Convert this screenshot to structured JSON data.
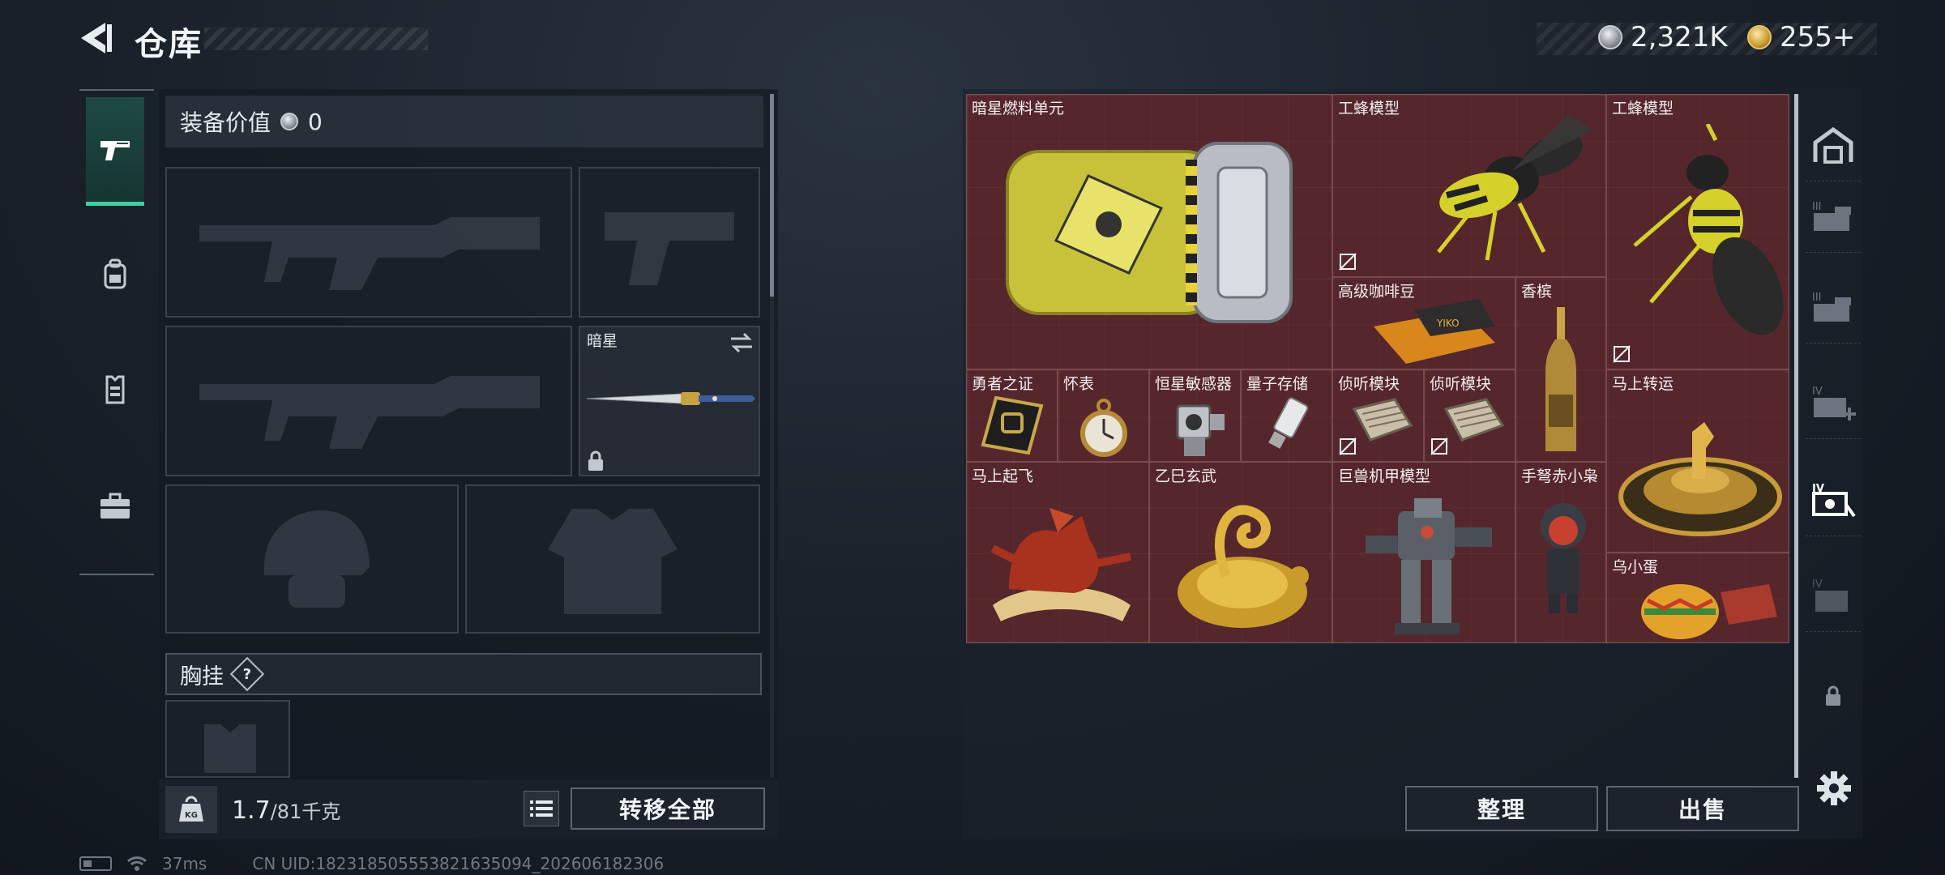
{
  "header": {
    "title": "仓库"
  },
  "currency": {
    "silver": "2,321K",
    "gold": "255+"
  },
  "loadout": {
    "equip_value_label": "装备价值",
    "equip_value": "0",
    "knife_name": "暗星",
    "chest_rig_label": "胸挂",
    "chest_rig_help": "?"
  },
  "weight": {
    "current": "1.7",
    "max": "/81",
    "unit": "千克"
  },
  "buttons": {
    "transfer_all": "转移全部",
    "sort": "整理",
    "sell": "出售"
  },
  "stash": {
    "items": [
      {
        "name": "暗星燃料单元",
        "icon": "fuel-cell-icon"
      },
      {
        "name": "工蜂模型",
        "icon": "wasp-model-icon"
      },
      {
        "name": "工蜂模型",
        "icon": "wasp-model-icon"
      },
      {
        "name": "高级咖啡豆",
        "icon": "coffee-beans-icon"
      },
      {
        "name": "香槟",
        "icon": "champagne-icon"
      },
      {
        "name": "勇者之证",
        "icon": "badge-icon"
      },
      {
        "name": "怀表",
        "icon": "pocket-watch-icon"
      },
      {
        "name": "恒星敏感器",
        "icon": "star-sensor-icon"
      },
      {
        "name": "量子存储",
        "icon": "quantum-storage-icon"
      },
      {
        "name": "侦听模块",
        "icon": "listening-module-icon"
      },
      {
        "name": "侦听模块",
        "icon": "listening-module-icon"
      },
      {
        "name": "马上转运",
        "icon": "horse-turntable-icon"
      },
      {
        "name": "马上起飞",
        "icon": "horse-statue-icon"
      },
      {
        "name": "乙巳玄武",
        "icon": "golden-turtle-icon"
      },
      {
        "name": "巨兽机甲模型",
        "icon": "mech-model-icon"
      },
      {
        "name": "手弩赤小枭",
        "icon": "figurine-icon"
      },
      {
        "name": "乌小蛋",
        "icon": "egg-icon"
      }
    ]
  },
  "status": {
    "ping": "37ms",
    "uid": "CN UID:18231850555382163509​4_202606182306"
  },
  "colors": {
    "accent": "#3fd1a1",
    "stash_bg": "#4a2227"
  }
}
